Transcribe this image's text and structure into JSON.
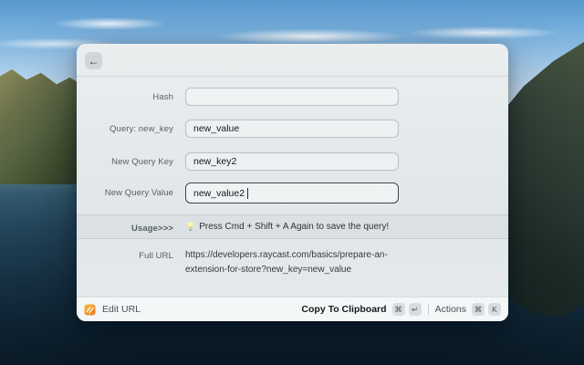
{
  "colors": {
    "app_icon_orange": "#f59b2d",
    "focus_border": "#41464a",
    "sky_blue": "#6fa9d9",
    "water_dark": "#0e2231"
  },
  "window": {
    "back_button": {
      "icon": "←"
    },
    "form": {
      "fields": [
        {
          "label": "Hash",
          "value": ""
        },
        {
          "label": "Query: new_key",
          "value": "new_value"
        },
        {
          "label": "New Query Key",
          "value": "new_key2"
        },
        {
          "label": "New Query Value",
          "value": "new_value2"
        }
      ],
      "usage": {
        "label": "Usage>>>",
        "icon": "💡",
        "text": "Press Cmd + Shift + A Again to save the query!"
      },
      "full_url": {
        "label": "Full URL",
        "lines": [
          "https://developers.raycast.com/basics/prepare-an-",
          "extension-for-store?new_key=new_value"
        ]
      }
    },
    "action_bar": {
      "app": {
        "label": "Edit URL"
      },
      "primary": {
        "label": "Copy To Clipboard",
        "keys": [
          "⌘",
          "↵"
        ]
      },
      "secondary": {
        "label": "Actions",
        "keys": [
          "⌘",
          "K"
        ]
      }
    }
  }
}
